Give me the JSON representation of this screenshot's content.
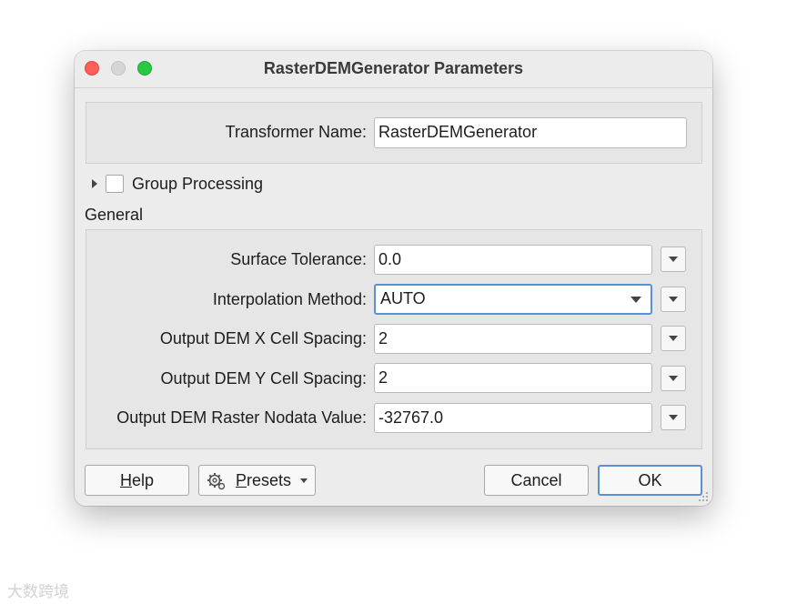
{
  "window": {
    "title": "RasterDEMGenerator Parameters"
  },
  "transformer": {
    "label": "Transformer Name:",
    "value": "RasterDEMGenerator"
  },
  "group_processing": {
    "label": "Group Processing",
    "checked": false
  },
  "general": {
    "heading": "General",
    "fields": [
      {
        "label": "Surface Tolerance:",
        "value": "0.0"
      },
      {
        "label": "Interpolation Method:",
        "value": "AUTO"
      },
      {
        "label": "Output DEM X Cell Spacing:",
        "value": "2"
      },
      {
        "label": "Output DEM Y Cell Spacing:",
        "value": "2"
      },
      {
        "label": "Output DEM Raster Nodata Value:",
        "value": "-32767.0"
      }
    ]
  },
  "buttons": {
    "help_first": "H",
    "help_rest": "elp",
    "presets_first": "P",
    "presets_rest": "resets",
    "cancel": "Cancel",
    "ok": "OK"
  },
  "watermark": "大数跨境",
  "colors": {
    "accent": "#5b8fd6",
    "close": "#ff5f57",
    "maximize": "#28c840",
    "minimize": "#d6d6d6"
  },
  "icons": [
    "expand-arrow-icon",
    "gear-icon",
    "chevron-down-icon",
    "resize-grip-icon"
  ]
}
